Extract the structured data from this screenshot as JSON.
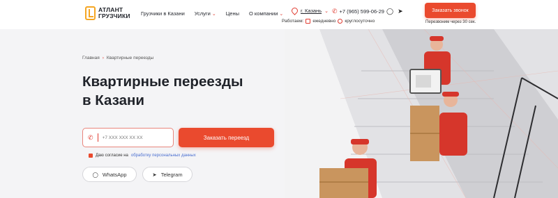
{
  "header": {
    "logo_line1": "АТЛАНТ",
    "logo_line2": "ГРУЗЧИКИ",
    "nav": [
      {
        "label": "Грузчики в Казани",
        "dropdown": false
      },
      {
        "label": "Услуги",
        "dropdown": true
      },
      {
        "label": "Цены",
        "dropdown": false
      },
      {
        "label": "О компании",
        "dropdown": true
      }
    ],
    "city": "г. Казань",
    "phone": "+7 (965) 599-06-29",
    "hours_label": "Работаем:",
    "hours_days": "ежедневно",
    "hours_time": "круглосуточно",
    "call_button": "Заказать звонок",
    "call_note": "Перезвоним через 30 сек."
  },
  "hero": {
    "breadcrumbs": [
      "Главная",
      "Квартирные переезды"
    ],
    "title_line1": "Квартирные переезды",
    "title_line2": "в Казани",
    "phone_placeholder": "+7 XXX XXX XX XX",
    "order_button": "Заказать переезд",
    "consent_text": "Даю согласие на",
    "consent_link": "обработку персональных данных",
    "whatsapp": "WhatsApp",
    "telegram": "Telegram"
  },
  "colors": {
    "accent": "#ea4a2e",
    "logo": "#f5a623",
    "link": "#4a6fd0"
  }
}
